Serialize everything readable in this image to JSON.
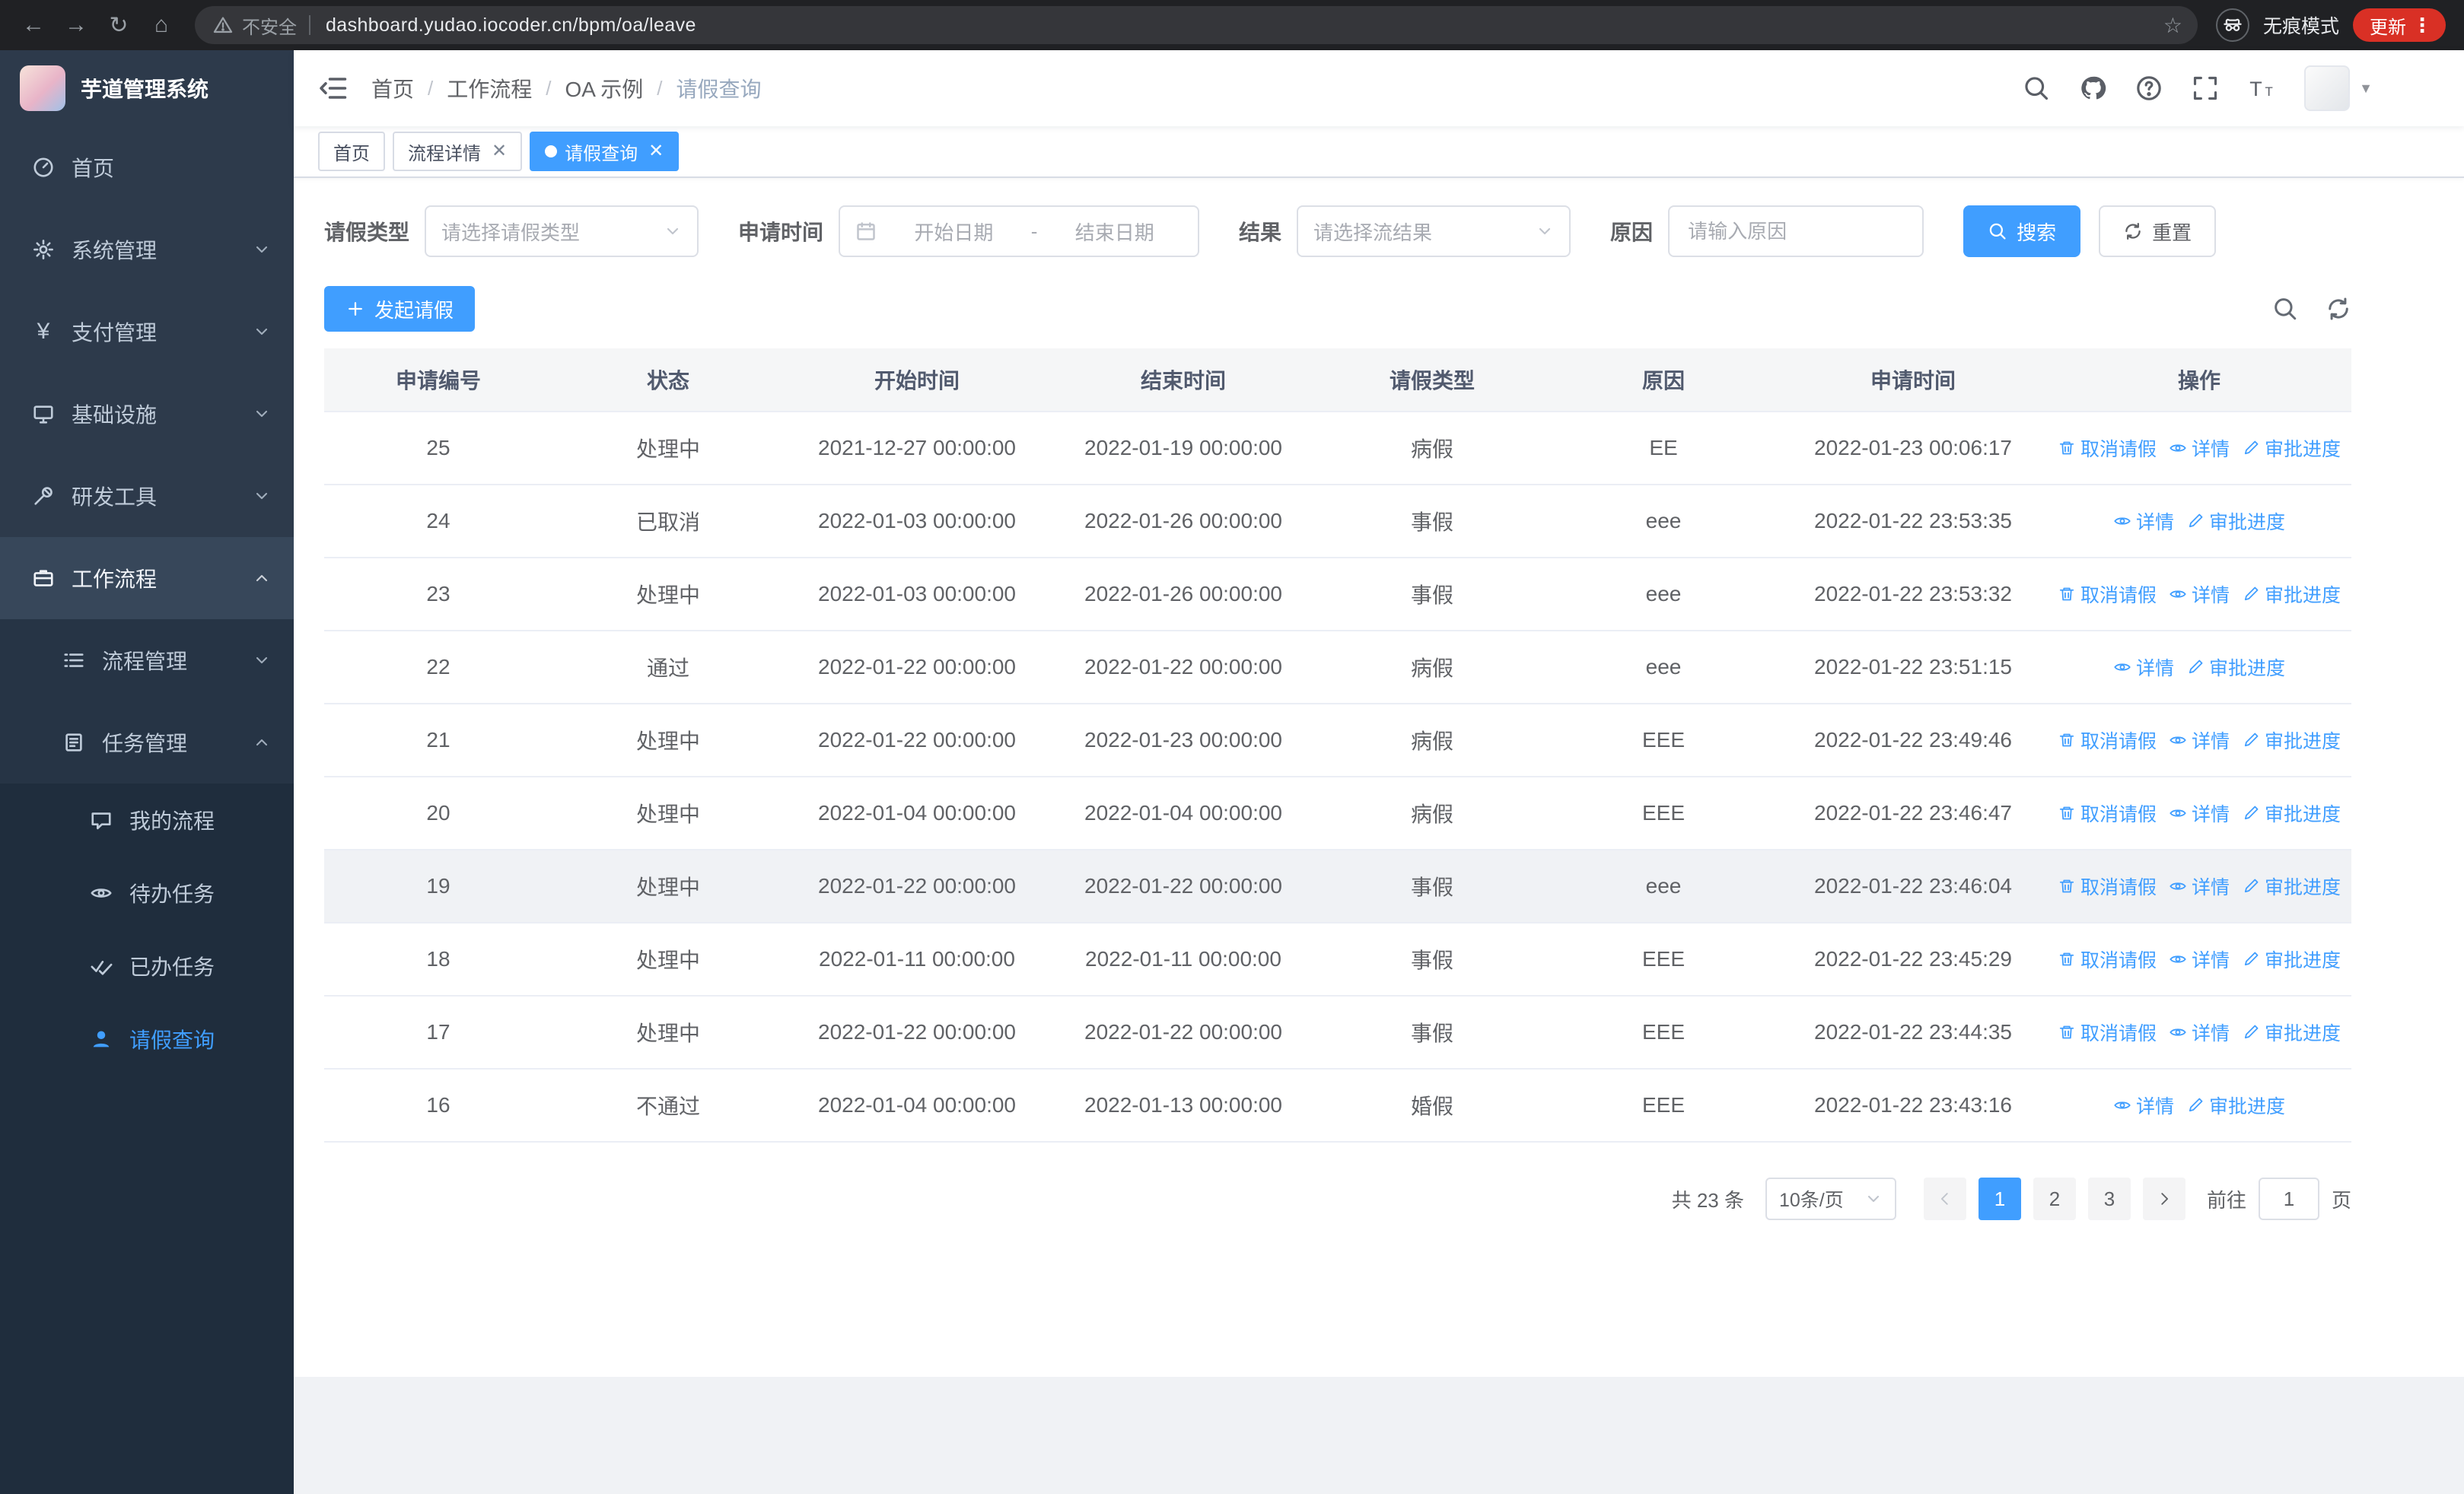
{
  "colors": {
    "primary": "#409eff",
    "sidebar_bg": "#2d3a4b",
    "sidebar_sub_bg": "#263445",
    "sidebar_deep_bg": "#1f2d3d",
    "browser_bar_bg": "#202124",
    "update_pill_bg": "#d93025",
    "table_header_bg": "#f5f6f7"
  },
  "browser": {
    "security_label": "不安全",
    "url": "dashboard.yudao.iocoder.cn/bpm/oa/leave",
    "incognito_label": "无痕模式",
    "update_label": "更新"
  },
  "sidebar": {
    "title": "芋道管理系统",
    "items": [
      {
        "label": "首页"
      },
      {
        "label": "系统管理"
      },
      {
        "label": "支付管理"
      },
      {
        "label": "基础设施"
      },
      {
        "label": "研发工具"
      },
      {
        "label": "工作流程"
      }
    ],
    "sub_items": [
      {
        "label": "流程管理"
      },
      {
        "label": "任务管理"
      }
    ],
    "task_items": [
      {
        "label": "我的流程"
      },
      {
        "label": "待办任务"
      },
      {
        "label": "已办任务"
      },
      {
        "label": "请假查询"
      }
    ]
  },
  "navbar": {
    "breadcrumb": [
      "首页",
      "工作流程",
      "OA 示例",
      "请假查询"
    ]
  },
  "tabs": [
    {
      "label": "首页",
      "closable": false,
      "active": false
    },
    {
      "label": "流程详情",
      "closable": true,
      "active": false
    },
    {
      "label": "请假查询",
      "closable": true,
      "active": true
    }
  ],
  "filters": {
    "leave_type_label": "请假类型",
    "leave_type_placeholder": "请选择请假类型",
    "apply_time_label": "申请时间",
    "start_date_placeholder": "开始日期",
    "range_separator": "-",
    "end_date_placeholder": "结束日期",
    "result_label": "结果",
    "result_placeholder": "请选择流结果",
    "reason_label": "原因",
    "reason_placeholder": "请输入原因",
    "search_label": "搜索",
    "reset_label": "重置"
  },
  "toolbar": {
    "create_label": "发起请假"
  },
  "table": {
    "columns": [
      "申请编号",
      "状态",
      "开始时间",
      "结束时间",
      "请假类型",
      "原因",
      "申请时间",
      "操作"
    ],
    "action_labels": {
      "cancel": "取消请假",
      "detail": "详情",
      "progress": "审批进度"
    },
    "rows": [
      {
        "id": "25",
        "status": "处理中",
        "start": "2021-12-27 00:00:00",
        "end": "2022-01-19 00:00:00",
        "type": "病假",
        "reason": "EE",
        "applied": "2022-01-23 00:06:17",
        "actions": [
          "cancel",
          "detail",
          "progress"
        ],
        "highlight": false
      },
      {
        "id": "24",
        "status": "已取消",
        "start": "2022-01-03 00:00:00",
        "end": "2022-01-26 00:00:00",
        "type": "事假",
        "reason": "eee",
        "applied": "2022-01-22 23:53:35",
        "actions": [
          "detail",
          "progress"
        ],
        "highlight": false
      },
      {
        "id": "23",
        "status": "处理中",
        "start": "2022-01-03 00:00:00",
        "end": "2022-01-26 00:00:00",
        "type": "事假",
        "reason": "eee",
        "applied": "2022-01-22 23:53:32",
        "actions": [
          "cancel",
          "detail",
          "progress"
        ],
        "highlight": false
      },
      {
        "id": "22",
        "status": "通过",
        "start": "2022-01-22 00:00:00",
        "end": "2022-01-22 00:00:00",
        "type": "病假",
        "reason": "eee",
        "applied": "2022-01-22 23:51:15",
        "actions": [
          "detail",
          "progress"
        ],
        "highlight": false
      },
      {
        "id": "21",
        "status": "处理中",
        "start": "2022-01-22 00:00:00",
        "end": "2022-01-23 00:00:00",
        "type": "病假",
        "reason": "EEE",
        "applied": "2022-01-22 23:49:46",
        "actions": [
          "cancel",
          "detail",
          "progress"
        ],
        "highlight": false
      },
      {
        "id": "20",
        "status": "处理中",
        "start": "2022-01-04 00:00:00",
        "end": "2022-01-04 00:00:00",
        "type": "病假",
        "reason": "EEE",
        "applied": "2022-01-22 23:46:47",
        "actions": [
          "cancel",
          "detail",
          "progress"
        ],
        "highlight": false
      },
      {
        "id": "19",
        "status": "处理中",
        "start": "2022-01-22 00:00:00",
        "end": "2022-01-22 00:00:00",
        "type": "事假",
        "reason": "eee",
        "applied": "2022-01-22 23:46:04",
        "actions": [
          "cancel",
          "detail",
          "progress"
        ],
        "highlight": true
      },
      {
        "id": "18",
        "status": "处理中",
        "start": "2022-01-11 00:00:00",
        "end": "2022-01-11 00:00:00",
        "type": "事假",
        "reason": "EEE",
        "applied": "2022-01-22 23:45:29",
        "actions": [
          "cancel",
          "detail",
          "progress"
        ],
        "highlight": false
      },
      {
        "id": "17",
        "status": "处理中",
        "start": "2022-01-22 00:00:00",
        "end": "2022-01-22 00:00:00",
        "type": "事假",
        "reason": "EEE",
        "applied": "2022-01-22 23:44:35",
        "actions": [
          "cancel",
          "detail",
          "progress"
        ],
        "highlight": false
      },
      {
        "id": "16",
        "status": "不通过",
        "start": "2022-01-04 00:00:00",
        "end": "2022-01-13 00:00:00",
        "type": "婚假",
        "reason": "EEE",
        "applied": "2022-01-22 23:43:16",
        "actions": [
          "detail",
          "progress"
        ],
        "highlight": false
      }
    ]
  },
  "pagination": {
    "total_label": "共 23 条",
    "page_size_label": "10条/页",
    "pages": [
      "1",
      "2",
      "3"
    ],
    "active_page": "1",
    "goto_label": "前往",
    "goto_value": "1",
    "goto_suffix": "页"
  }
}
